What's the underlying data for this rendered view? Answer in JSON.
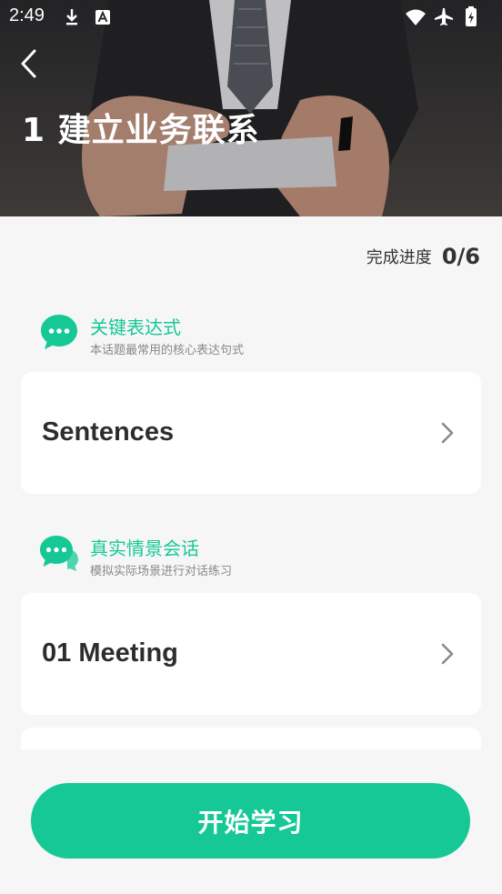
{
  "status_bar": {
    "time": "2:49",
    "left_icons": [
      "download-icon",
      "app-a-icon"
    ],
    "right_icons": [
      "wifi-icon",
      "airplane-icon",
      "battery-charging-icon"
    ]
  },
  "header": {
    "title": "1 建立业务联系",
    "back_icon": "chevron-left-icon"
  },
  "progress": {
    "label": "完成进度",
    "value": "0/6"
  },
  "sections": [
    {
      "title": "关键表达式",
      "subtitle": "本话题最常用的核心表达句式",
      "icon": "chat-bubble-icon",
      "items": [
        {
          "label": "Sentences"
        }
      ]
    },
    {
      "title": "真实情景会话",
      "subtitle": "模拟实际场景进行对话练习",
      "icon": "conversation-icon",
      "items": [
        {
          "label": "01 Meeting"
        }
      ]
    }
  ],
  "footer": {
    "start_label": "开始学习"
  },
  "colors": {
    "accent": "#16c896",
    "background": "#f6f6f6",
    "card": "#ffffff"
  }
}
